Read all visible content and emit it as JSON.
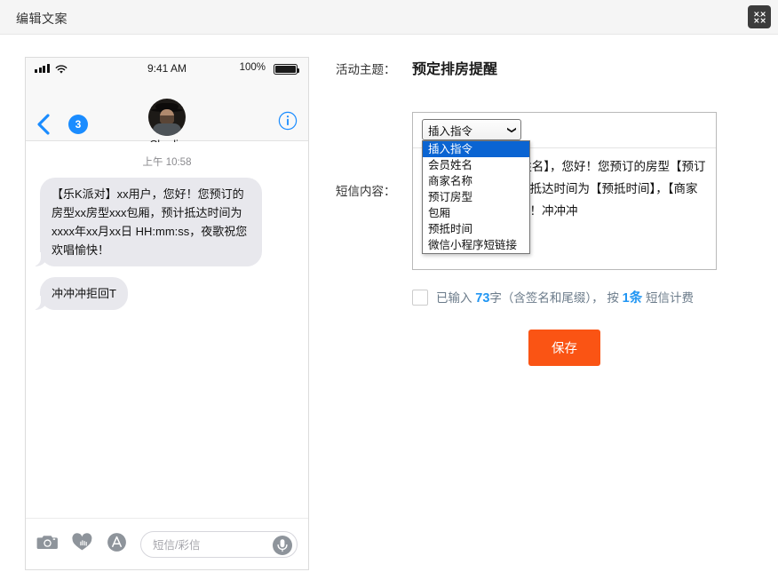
{
  "window": {
    "title": "编辑文案",
    "fullscreen_icon": "expand-collapse-arrows-icon"
  },
  "phone_preview": {
    "status_bar": {
      "signal_icon": "signal-bars-icon",
      "wifi_icon": "wifi-icon",
      "time": "9:41 AM",
      "battery_percent": "100%",
      "battery_icon": "battery-full-icon"
    },
    "nav": {
      "back_icon": "back-chevron-icon",
      "unread_badge": "3",
      "avatar": "contact-avatar",
      "contact_name": "Charlie",
      "info_icon": "info-circle-icon"
    },
    "conversation": {
      "timestamp": "上午 10:58",
      "messages": [
        "【乐K派对】xx用户，您好！您预订的房型xx房型xxx包厢，预计抵达时间为xxxx年xx月xx日 HH:mm:ss，夜歌祝您欢唱愉快！",
        "冲冲冲拒回T"
      ]
    },
    "bottom_bar": {
      "camera_icon": "camera-icon",
      "digital_touch_icon": "heart-hand-icon",
      "appstore_icon": "app-store-icon",
      "input_placeholder": "短信/彩信",
      "mic_icon": "microphone-icon"
    }
  },
  "form": {
    "topic_label": "活动主题：",
    "topic_value": "预定排房提醒",
    "content_label": "短信内容：",
    "insert_select": {
      "selected": "插入指令",
      "caret_icon": "chevron-down-icon",
      "options": [
        "插入指令",
        "会员姓名",
        "商家名称",
        "预订房型",
        "包厢",
        "预抵时间",
        "微信小程序短链接"
      ]
    },
    "content_value": "【乐K派对】【会员姓名】，您好！您预订的房型【预订房型】【包厢】，预计抵达时间为【预抵时间】，【商家名称】祝您欢唱愉快！冲冲冲",
    "count": {
      "checkbox_checked": false,
      "prefix": "已输入 ",
      "char_count": "73",
      "middle": "字（含签名和尾缀）， 按 ",
      "sms_count": "1条",
      "suffix": " 短信计费"
    },
    "save_label": "保存"
  },
  "colors": {
    "accent_orange": "#fa5414",
    "accent_blue": "#2196f3",
    "select_highlight": "#0a64d2",
    "bubble_gray": "#e8e8ed"
  }
}
